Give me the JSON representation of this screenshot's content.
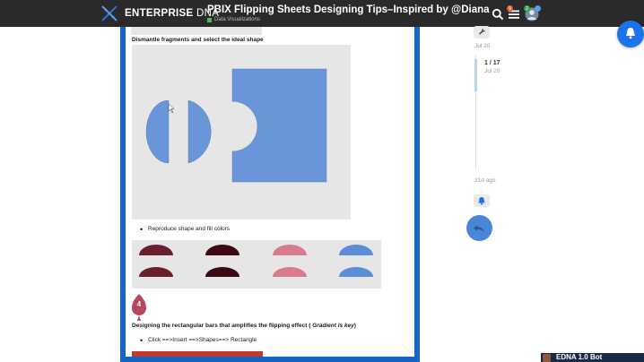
{
  "header": {
    "brand_name": "ENTERPRISE",
    "brand_suffix": "DNA",
    "topic_title": "PBIX Flipping Sheets Designing Tips–Inspired by @Diana",
    "category": "Data Visualizations",
    "category_color": "#5ab552",
    "notification_count": "9",
    "avatar_badge": "2",
    "icons": [
      "dna-logo-icon",
      "search-icon",
      "hamburger-menu-icon",
      "user-avatar-icon"
    ]
  },
  "post": {
    "section1_heading": "Dismantle fragments and select the ideal shape",
    "bullet1": "Reproduce shape and fill colors",
    "step_number": "4",
    "heading4_text": "Designing the rectangular bars that amplifies the flipping effect ( ",
    "heading4_emph": "Gradient is key",
    "heading4_end": ")",
    "bullet2": "Click ==>Insert ==>Shapes==> Rectangle",
    "shape_colors": [
      "#6b1f2e",
      "#3d0a14",
      "#d97a8e",
      "#5b8ed6"
    ],
    "shape_fill": "#6a95d8",
    "accent_frame": "#1565c0"
  },
  "timeline": {
    "date_top": "Jul 20",
    "progress": "1 / 17",
    "date_progress": "Jul 20",
    "last_activity": "21d ago"
  },
  "bot": {
    "label": "EDNA 1.0 Bot"
  }
}
